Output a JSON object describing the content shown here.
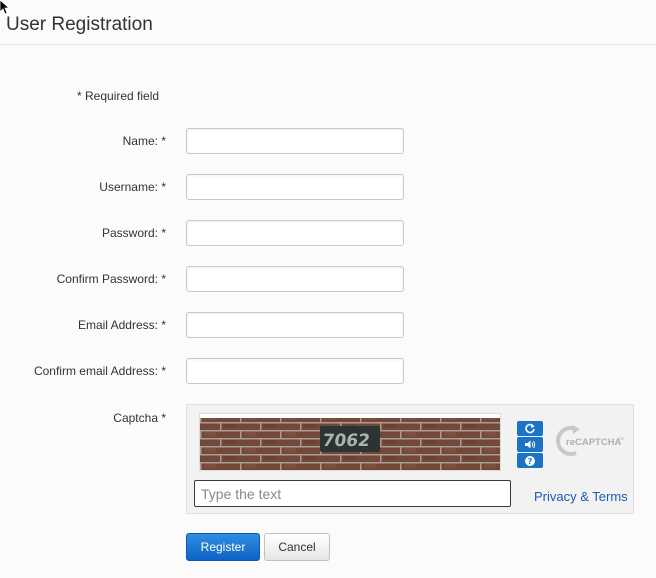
{
  "page": {
    "title": "User Registration",
    "required_note": "* Required field"
  },
  "form": {
    "fields": [
      {
        "label": "Name: *",
        "value": ""
      },
      {
        "label": "Username: *",
        "value": ""
      },
      {
        "label": "Password: *",
        "value": ""
      },
      {
        "label": "Confirm Password: *",
        "value": ""
      },
      {
        "label": "Email Address: *",
        "value": ""
      },
      {
        "label": "Confirm email Address: *",
        "value": ""
      }
    ],
    "captcha": {
      "label": "Captcha *",
      "image_text": "7062",
      "input_placeholder": "Type the text",
      "privacy_link": "Privacy & Terms",
      "logo_text": "reCAPTCHA",
      "logo_tm": "TM",
      "controls": [
        "refresh-icon",
        "audio-icon",
        "help-icon"
      ]
    },
    "buttons": {
      "register": "Register",
      "cancel": "Cancel"
    }
  },
  "colors": {
    "primary": "#1a73c7",
    "link": "#1a5bb5"
  }
}
